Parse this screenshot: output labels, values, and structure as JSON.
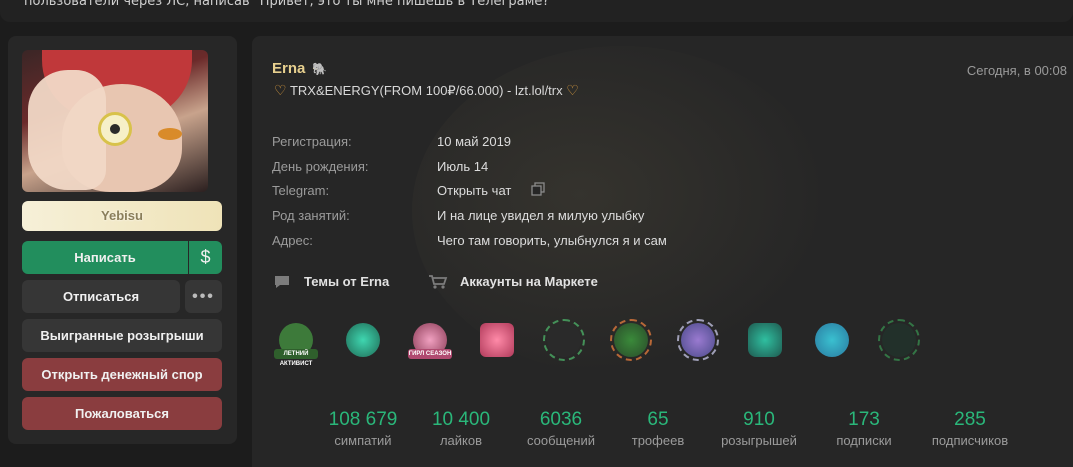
{
  "topbar": {
    "text": "пользователи через ЛС, написав \"Привет, это ты мне пишешь в Телеграме?\""
  },
  "sidebar": {
    "nickname_plate": "Yebisu",
    "buttons": {
      "write": "Написать",
      "money": "$",
      "unsubscribe": "Отписаться",
      "more": "•••",
      "giveaways": "Выигранные розыгрыши",
      "dispute": "Открыть денежный спор",
      "report": "Пожаловаться"
    },
    "colors": {
      "write_bg": "#228e5d",
      "danger_bg": "#8a3d3f",
      "neutral_bg": "#363636"
    }
  },
  "profile": {
    "username": "Erna",
    "username_color": "#e6cf8e",
    "timestamp": "Сегодня, в 00:08",
    "status_text": "TRX&ENERGY(FROM 100₽/66.000) - lzt.lol/trx",
    "status_icon": "heart-icon",
    "info": [
      {
        "label": "Регистрация:",
        "value": "10 май 2019"
      },
      {
        "label": "День рождения:",
        "value": "Июль 14"
      },
      {
        "label": "Telegram:",
        "value": "Открыть чат"
      },
      {
        "label": "Род занятий:",
        "value": "И на лице увидел я милую улыбку"
      },
      {
        "label": "Адрес:",
        "value": "Чего там говорить, улыбнулся я и сам"
      }
    ],
    "links": {
      "threads": "Темы от Erna",
      "market": "Аккаунты на Маркете"
    },
    "trophies": [
      {
        "icon": "summer-activist-trophy-icon",
        "tag": "ЛЕТНИЙ АКТИВИСТ",
        "color": "#3d7a3a"
      },
      {
        "icon": "hummingbird-trophy-icon",
        "tag": "",
        "color": "#1f6a55"
      },
      {
        "icon": "pink-cat-trophy-icon",
        "tag": "ГИРЛ СЕАЗОН",
        "color": "#8a3a55"
      },
      {
        "icon": "pink-card-trophy-icon",
        "tag": "",
        "color": "#b03a5a"
      },
      {
        "icon": "wreath-trophy-icon",
        "tag": "",
        "color": "#2a5a3a"
      },
      {
        "icon": "autumn-wreath-trophy-icon",
        "tag": "",
        "color": "#7a5a2a"
      },
      {
        "icon": "silver-wreath-trophy-icon",
        "tag": "",
        "color": "#4a4a8a"
      },
      {
        "icon": "handshake-trophy-icon",
        "tag": "",
        "color": "#1f7a6a"
      },
      {
        "icon": "perry-trophy-icon",
        "tag": "",
        "color": "#2a7aa0"
      },
      {
        "icon": "lock-trophy-icon",
        "tag": "",
        "color": "#2a4a3a"
      }
    ],
    "stats": [
      {
        "value": "108 679",
        "label": "симпатий"
      },
      {
        "value": "10 400",
        "label": "лайков"
      },
      {
        "value": "6036",
        "label": "сообщений"
      },
      {
        "value": "65",
        "label": "трофеев"
      },
      {
        "value": "910",
        "label": "розыгрышей"
      },
      {
        "value": "173",
        "label": "подписки"
      },
      {
        "value": "285",
        "label": "подписчиков"
      }
    ],
    "stat_color": "#2ab77a"
  }
}
